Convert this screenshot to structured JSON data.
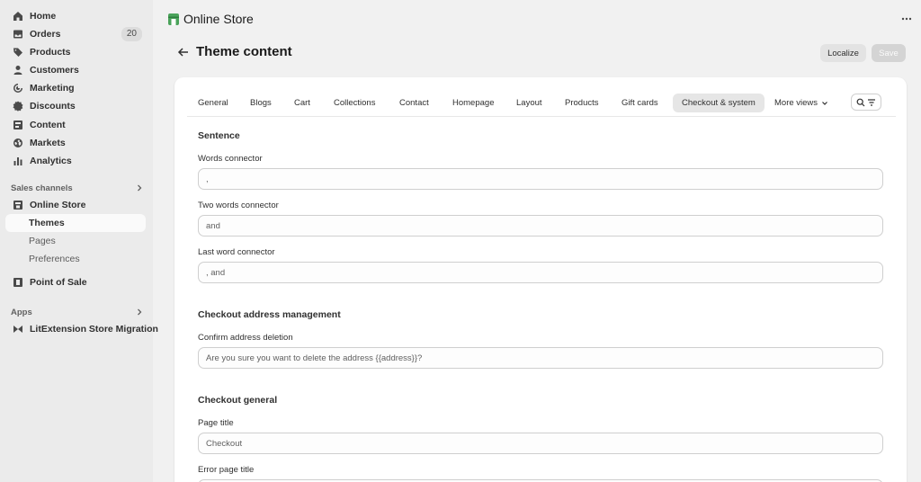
{
  "sidebar": {
    "items": [
      {
        "label": "Home",
        "icon": "home-icon"
      },
      {
        "label": "Orders",
        "icon": "orders-icon",
        "badge": "20"
      },
      {
        "label": "Products",
        "icon": "tag-icon"
      },
      {
        "label": "Customers",
        "icon": "person-icon"
      },
      {
        "label": "Marketing",
        "icon": "target-icon"
      },
      {
        "label": "Discounts",
        "icon": "discount-icon"
      },
      {
        "label": "Content",
        "icon": "content-icon"
      },
      {
        "label": "Markets",
        "icon": "globe-icon"
      },
      {
        "label": "Analytics",
        "icon": "bar-chart-icon"
      }
    ],
    "sales_channels": {
      "heading": "Sales channels",
      "online_store": "Online Store",
      "sub_items": [
        "Themes",
        "Pages",
        "Preferences"
      ],
      "point_of_sale": "Point of Sale"
    },
    "apps": {
      "heading": "Apps",
      "items": [
        "LitExtension Store Migration"
      ]
    }
  },
  "topbar": {
    "title": "Online Store"
  },
  "page": {
    "title": "Theme content",
    "localize_label": "Localize",
    "save_label": "Save"
  },
  "tabs": [
    "General",
    "Blogs",
    "Cart",
    "Collections",
    "Contact",
    "Homepage",
    "Layout",
    "Products",
    "Gift cards",
    "Checkout & system",
    "More views"
  ],
  "active_tab": "Checkout & system",
  "sections": [
    {
      "title": "Sentence",
      "fields": [
        {
          "label": "Words connector",
          "value": ","
        },
        {
          "label": "Two words connector",
          "value": "and"
        },
        {
          "label": "Last word connector",
          "value": ", and"
        }
      ]
    },
    {
      "title": "Checkout address management",
      "fields": [
        {
          "label": "Confirm address deletion",
          "value": "Are you sure you want to delete the address {{address}}?"
        }
      ]
    },
    {
      "title": "Checkout general",
      "fields": [
        {
          "label": "Page title",
          "value": "Checkout"
        },
        {
          "label": "Error page title",
          "value": ""
        }
      ]
    }
  ],
  "colors": {
    "background": "#f1f1f1",
    "sidebar": "#ebebeb",
    "card": "#ffffff",
    "app_icon": "#4aa35a"
  }
}
